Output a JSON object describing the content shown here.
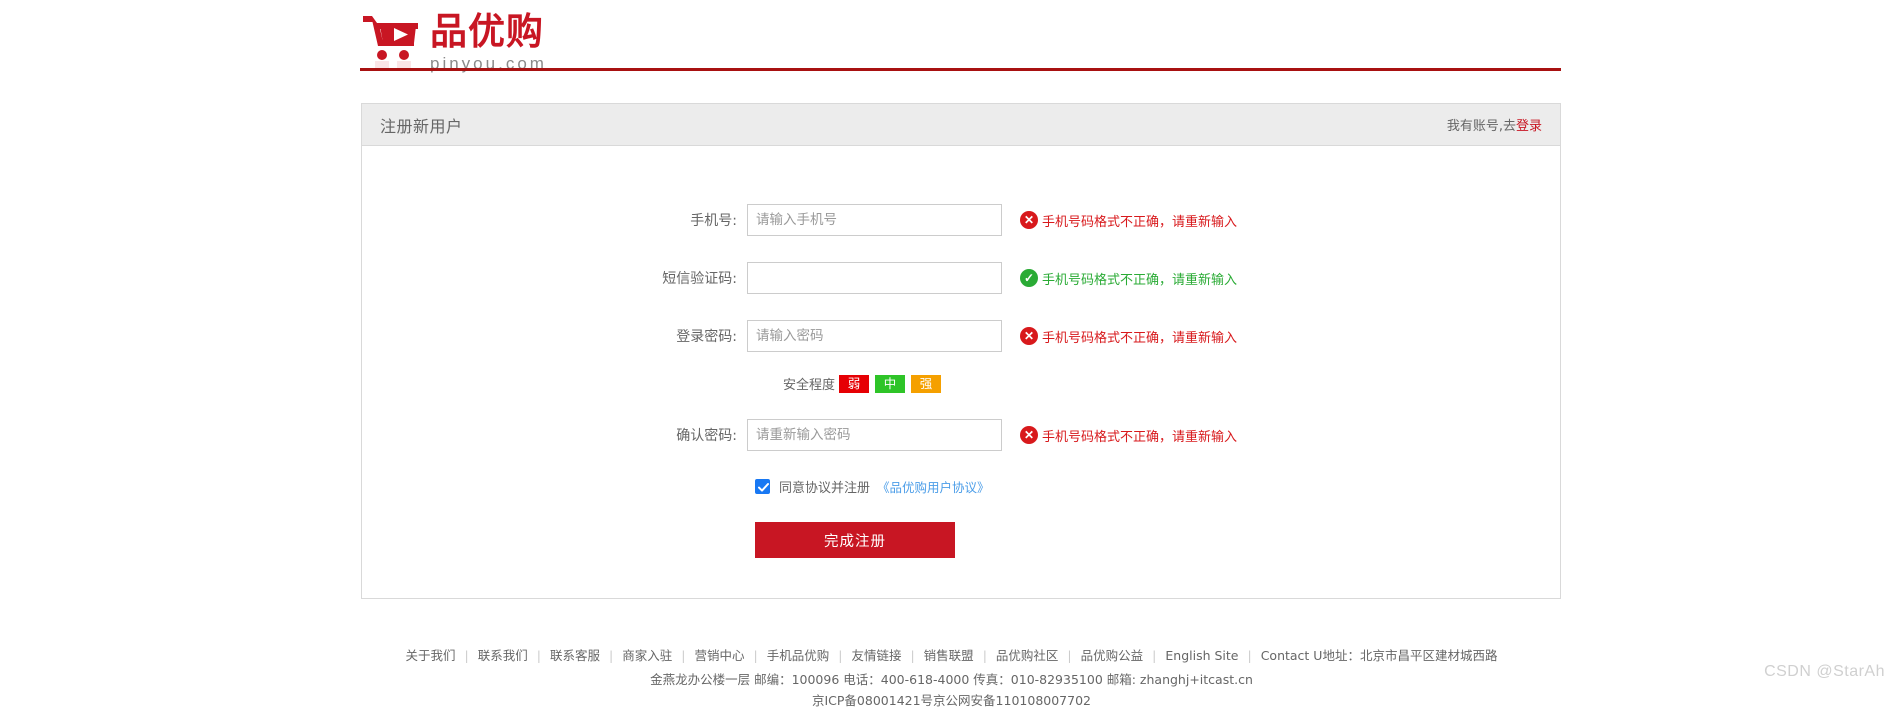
{
  "header": {
    "logo_cn": "品优购",
    "logo_en": "pinyou.com",
    "logo_icon": "shopping-cart-icon",
    "brand_color": "#c81623",
    "rule_color": "#a81111"
  },
  "register_box": {
    "title": "注册新用户",
    "have_account_text": "我有账号,去",
    "login_link": "登录"
  },
  "form": {
    "fields": [
      {
        "label": "手机号:",
        "placeholder": "请输入手机号",
        "value": "",
        "type": "text",
        "message": "手机号码格式不正确，请重新输入",
        "status": "error",
        "icon": "error-circle-icon"
      },
      {
        "label": "短信验证码:",
        "placeholder": "",
        "value": "",
        "type": "text",
        "message": "手机号码格式不正确，请重新输入",
        "status": "ok",
        "icon": "success-circle-icon"
      },
      {
        "label": "登录密码:",
        "placeholder": "请输入密码",
        "value": "",
        "type": "password",
        "message": "手机号码格式不正确，请重新输入",
        "status": "error",
        "icon": "error-circle-icon"
      },
      {
        "label": "确认密码:",
        "placeholder": "请重新输入密码",
        "value": "",
        "type": "password",
        "message": "手机号码格式不正确，请重新输入",
        "status": "error",
        "icon": "error-circle-icon"
      }
    ],
    "strength": {
      "label": "安全程度",
      "levels": [
        {
          "text": "弱",
          "color": "#e60004"
        },
        {
          "text": "中",
          "color": "#2ec428"
        },
        {
          "text": "强",
          "color": "#f5a000"
        }
      ]
    },
    "agreement": {
      "checked": true,
      "text": "同意协议并注册",
      "link": "《品优购用户协议》",
      "link_color": "#4b9de8"
    },
    "submit_label": "完成注册",
    "submit_color": "#c81623"
  },
  "footer": {
    "links": [
      "关于我们",
      "联系我们",
      "联系客服",
      "商家入驻",
      "营销中心",
      "手机品优购",
      "友情链接",
      "销售联盟",
      "品优购社区",
      "品优购公益",
      "English Site"
    ],
    "separator": "|",
    "contact_tail": "Contact U地址：北京市昌平区建材城西路",
    "line2": "金燕龙办公楼一层 邮编：100096 电话：400-618-4000 传真：010-82935100 邮箱: zhanghj+itcast.cn",
    "line3": "京ICP备08001421号京公网安备110108007702"
  },
  "watermark": "CSDN @StarAh"
}
